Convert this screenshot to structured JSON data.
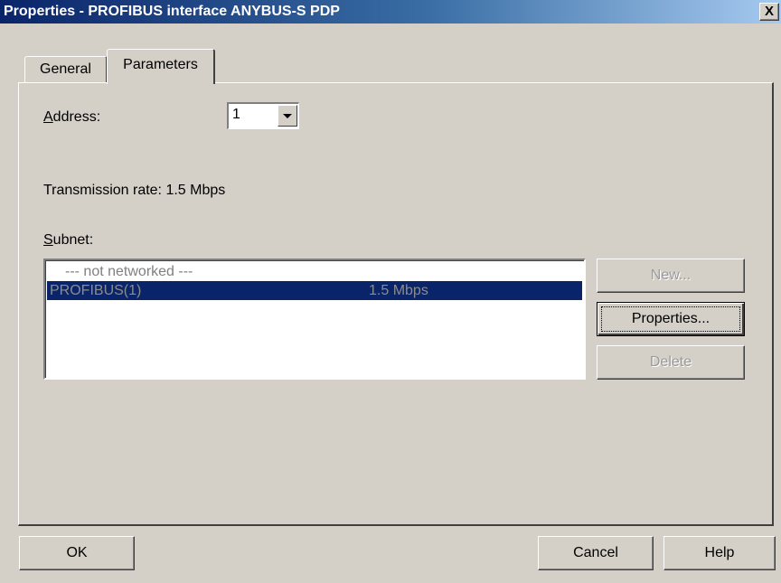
{
  "window": {
    "title": "Properties - PROFIBUS interface  ANYBUS-S PDP",
    "close_label": "X"
  },
  "tabs": [
    {
      "label": "General"
    },
    {
      "label": "Parameters"
    }
  ],
  "address": {
    "label": "Address:",
    "value": "1"
  },
  "transmission_rate": "Transmission rate: 1.5 Mbps",
  "subnet": {
    "label": "Subnet:",
    "rows": [
      {
        "name": "--- not networked ---",
        "rate": ""
      },
      {
        "name": "PROFIBUS(1)",
        "rate": "1.5 Mbps"
      }
    ],
    "selected_index": 1
  },
  "side_buttons": {
    "new": "New...",
    "properties": "Properties...",
    "delete": "Delete"
  },
  "footer": {
    "ok": "OK",
    "cancel": "Cancel",
    "help": "Help"
  },
  "colors": {
    "title_bar": "#0a246a",
    "selection": "#0a246a",
    "face": "#d4d0c8"
  }
}
